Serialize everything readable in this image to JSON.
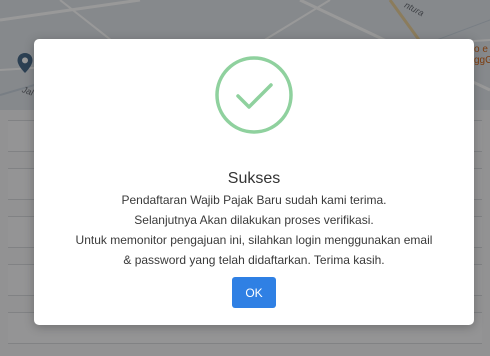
{
  "map": {
    "label_left": "Jal",
    "label_right_top": "ntura",
    "label_edge_1": "o e",
    "label_edge_2": "ggG"
  },
  "modal": {
    "title": "Sukses",
    "message_lines": [
      "Pendaftaran Wajib Pajak Baru sudah kami terima.",
      "Selanjutnya Akan dilakukan proses verifikasi.",
      "Untuk memonitor pengajuan ini, silahkan login menggunakan email",
      "& password yang telah didaftarkan. Terima kasih."
    ],
    "ok_label": "OK"
  },
  "colors": {
    "success_green": "#8fd19e",
    "button_blue": "#2f80e4",
    "overlay": "rgba(0,0,0,0.40)"
  },
  "icons": {
    "success": "check-circle-icon",
    "map_pin": "map-pin-icon"
  }
}
